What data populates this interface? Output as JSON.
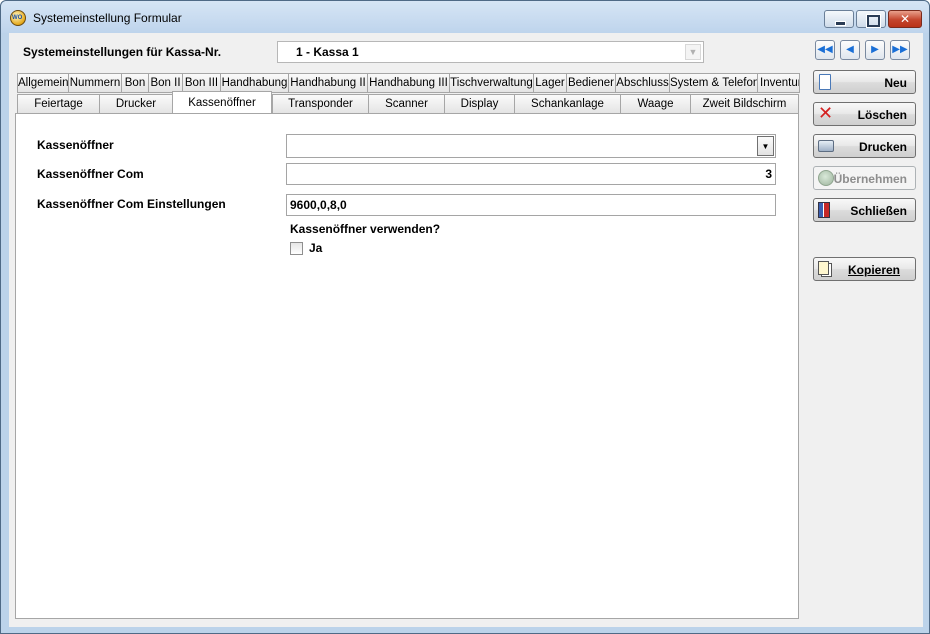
{
  "window": {
    "title": "Systemeinstellung Formular"
  },
  "header": {
    "kassa_label": "Systemeinstellungen für Kassa-Nr.",
    "kassa_value": "1 - Kassa 1"
  },
  "tabs_row1": [
    "Allgemein",
    "Nummern",
    "Bon",
    "Bon II",
    "Bon III",
    "Handhabung",
    "Handhabung II",
    "Handhabung III",
    "Tischverwaltung",
    "Lager",
    "Bediener",
    "Abschluss",
    "System & Telefon",
    "Inventur"
  ],
  "tabs_row2": [
    "Feiertage",
    "Drucker",
    "Kassenöffner",
    "Transponder",
    "Scanner",
    "Display",
    "Schankanlage",
    "Waage",
    "Zweit Bildschirm"
  ],
  "active_tab": "Kassenöffner",
  "form": {
    "kassenoeffner_label": "Kassenöffner",
    "kassenoeffner_value": "",
    "com_label": "Kassenöffner Com",
    "com_value": "3",
    "com_settings_label": "Kassenöffner Com Einstellungen",
    "com_settings_value": "9600,0,8,0",
    "use_question": "Kassenöffner verwenden?",
    "use_checkbox_label": "Ja",
    "use_checked": false
  },
  "sidebar": {
    "nav_icons": [
      "first-record-icon",
      "previous-record-icon",
      "next-record-icon",
      "last-record-icon"
    ],
    "new_label": "Neu",
    "delete_label": "Löschen",
    "print_label": "Drucken",
    "apply_label": "Übernehmen",
    "close_label": "Schließen",
    "copy_label": "Kopieren"
  },
  "colors": {
    "window_frame": "#bcd3ea",
    "client_bg": "#f0f0f0",
    "nav_arrow": "#1a6fd6",
    "delete_icon": "#d42020"
  }
}
